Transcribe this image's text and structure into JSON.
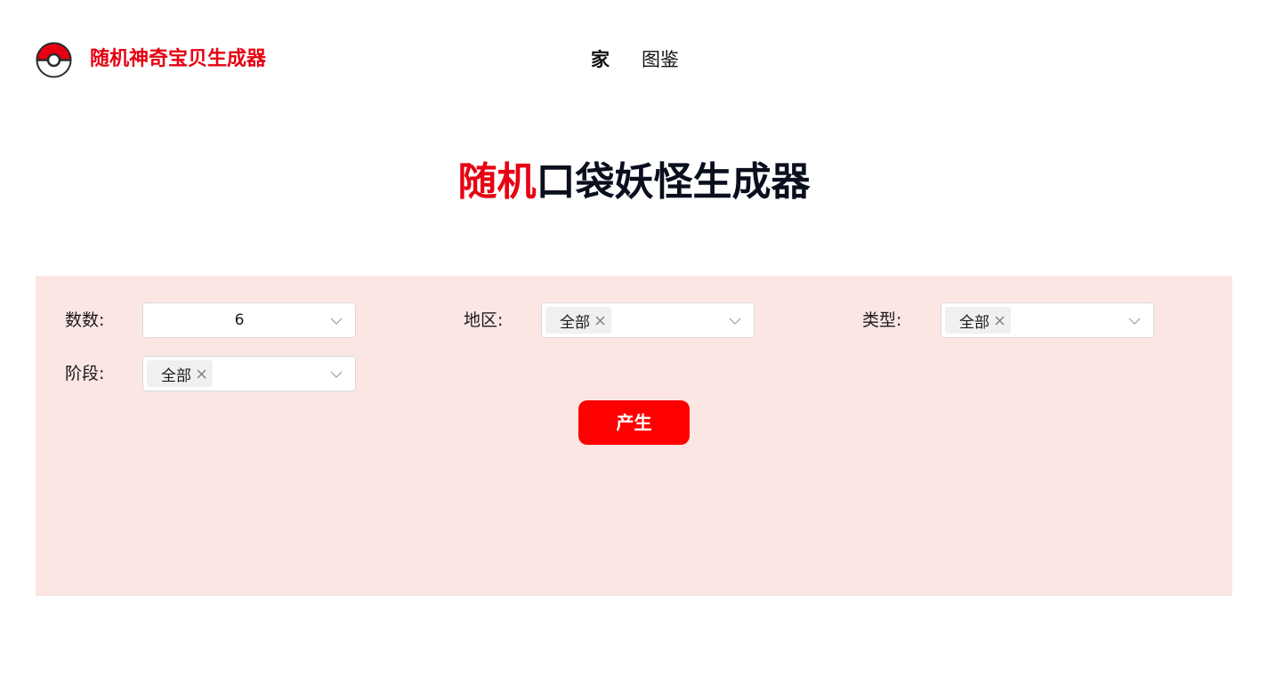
{
  "header": {
    "brand": "随机神奇宝贝生成器",
    "nav": [
      {
        "label": "家",
        "active": true
      },
      {
        "label": "图鉴",
        "active": false
      }
    ]
  },
  "hero": {
    "title_accent": "随机",
    "title_rest": "口袋妖怪生成器"
  },
  "form": {
    "count": {
      "label": "数数:",
      "value": "6"
    },
    "region": {
      "label": "地区:",
      "tag": "全部"
    },
    "type": {
      "label": "类型:",
      "tag": "全部"
    },
    "stage": {
      "label": "阶段:",
      "tag": "全部"
    },
    "generate_label": "产生"
  },
  "colors": {
    "accent": "#e60012",
    "button": "#ff0000",
    "panel_bg": "#fce6e4"
  },
  "icons": {
    "logo": "pokeball-icon",
    "dropdown": "chevron-down-icon",
    "remove_tag": "close-icon"
  }
}
